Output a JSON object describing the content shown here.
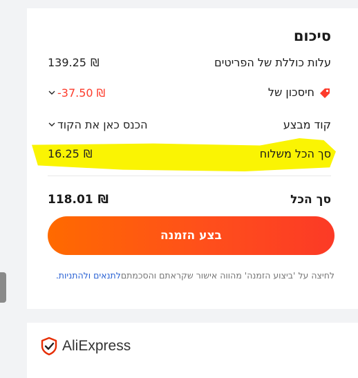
{
  "summary": {
    "title": "סיכום",
    "items_total_label": "עלות כוללת של הפריטים",
    "items_total_value": "139.25",
    "savings_label": "חיסכון של",
    "savings_value": "-37.50",
    "promo_label": "קוד מבצע",
    "promo_placeholder": "הכנס כאן את הקוד",
    "shipping_label": "סך הכל משלוח",
    "shipping_value": "16.25",
    "total_label": "סך הכל",
    "total_value": "118.01",
    "currency_symbol": "₪"
  },
  "order_button": {
    "label": "בצע הזמנה"
  },
  "terms": {
    "link_text": "לתנאים ולהתניות.",
    "text": "לחיצה על 'ביצוע הזמנה' מהווה אישור שקראתם והסכמתם"
  },
  "footer": {
    "brand": "AliExpress"
  },
  "colors": {
    "accent": "#ff5a1f",
    "discount": "#fd3b2b",
    "highlight": "#faf403",
    "link": "#2a62d4"
  },
  "icons": {
    "savings": "tag-icon",
    "dropdown": "chevron-down-icon",
    "brand": "shield-check-icon"
  }
}
